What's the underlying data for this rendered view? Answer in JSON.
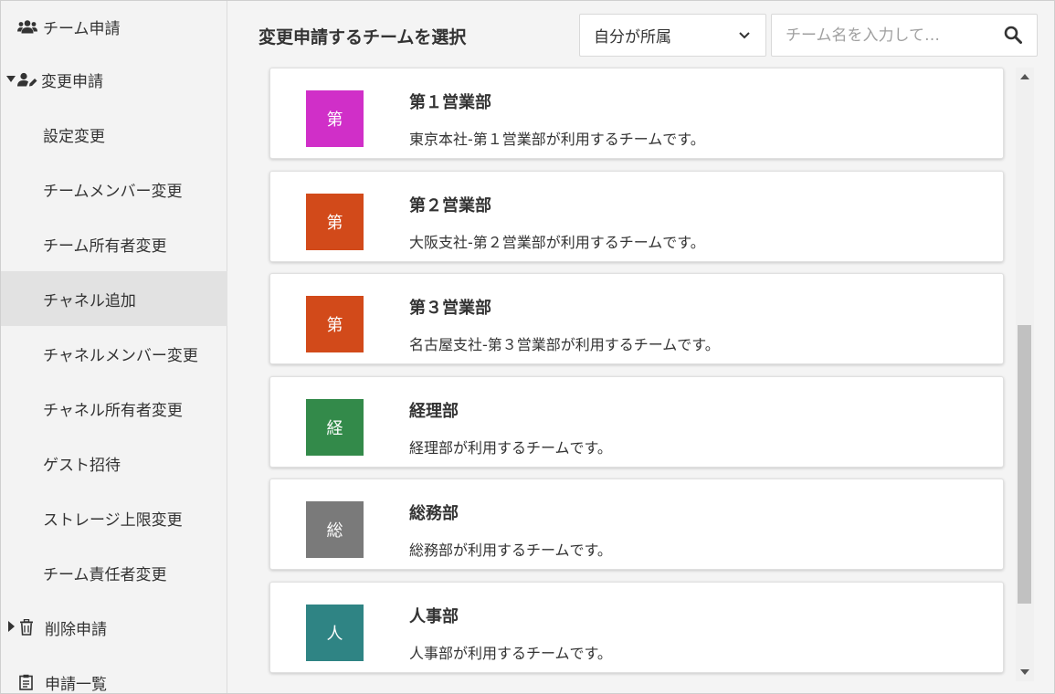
{
  "sidebar": {
    "top_item": {
      "label": "チーム申請",
      "icon": "team-icon"
    },
    "change_section": {
      "label": "変更申請",
      "icon": "user-edit-icon",
      "expanded": true
    },
    "change_items": [
      {
        "label": "設定変更"
      },
      {
        "label": "チームメンバー変更"
      },
      {
        "label": "チーム所有者変更"
      },
      {
        "label": "チャネル追加",
        "active": true
      },
      {
        "label": "チャネルメンバー変更"
      },
      {
        "label": "チャネル所有者変更"
      },
      {
        "label": "ゲスト招待"
      },
      {
        "label": "ストレージ上限変更"
      },
      {
        "label": "チーム責任者変更"
      }
    ],
    "delete_section": {
      "label": "削除申請",
      "icon": "trash-icon",
      "expanded": false
    },
    "list_section": {
      "label": "申請一覧",
      "icon": "clipboard-icon"
    }
  },
  "header": {
    "title": "変更申請するチームを選択",
    "filter": {
      "value": "自分が所属"
    },
    "search": {
      "placeholder": "チーム名を入力して…"
    }
  },
  "teams": [
    {
      "initial": "第",
      "name": "第１営業部",
      "description": "東京本社-第１営業部が利用するチームです。",
      "color": "#d02fc8"
    },
    {
      "initial": "第",
      "name": "第２営業部",
      "description": "大阪支社-第２営業部が利用するチームです。",
      "color": "#d24a1a"
    },
    {
      "initial": "第",
      "name": "第３営業部",
      "description": "名古屋支社-第３営業部が利用するチームです。",
      "color": "#d24a1a"
    },
    {
      "initial": "経",
      "name": "経理部",
      "description": "経理部が利用するチームです。",
      "color": "#338a4a"
    },
    {
      "initial": "総",
      "name": "総務部",
      "description": "総務部が利用するチームです。",
      "color": "#7a7a7a"
    },
    {
      "initial": "人",
      "name": "人事部",
      "description": "人事部が利用するチームです。",
      "color": "#2f8484"
    }
  ]
}
